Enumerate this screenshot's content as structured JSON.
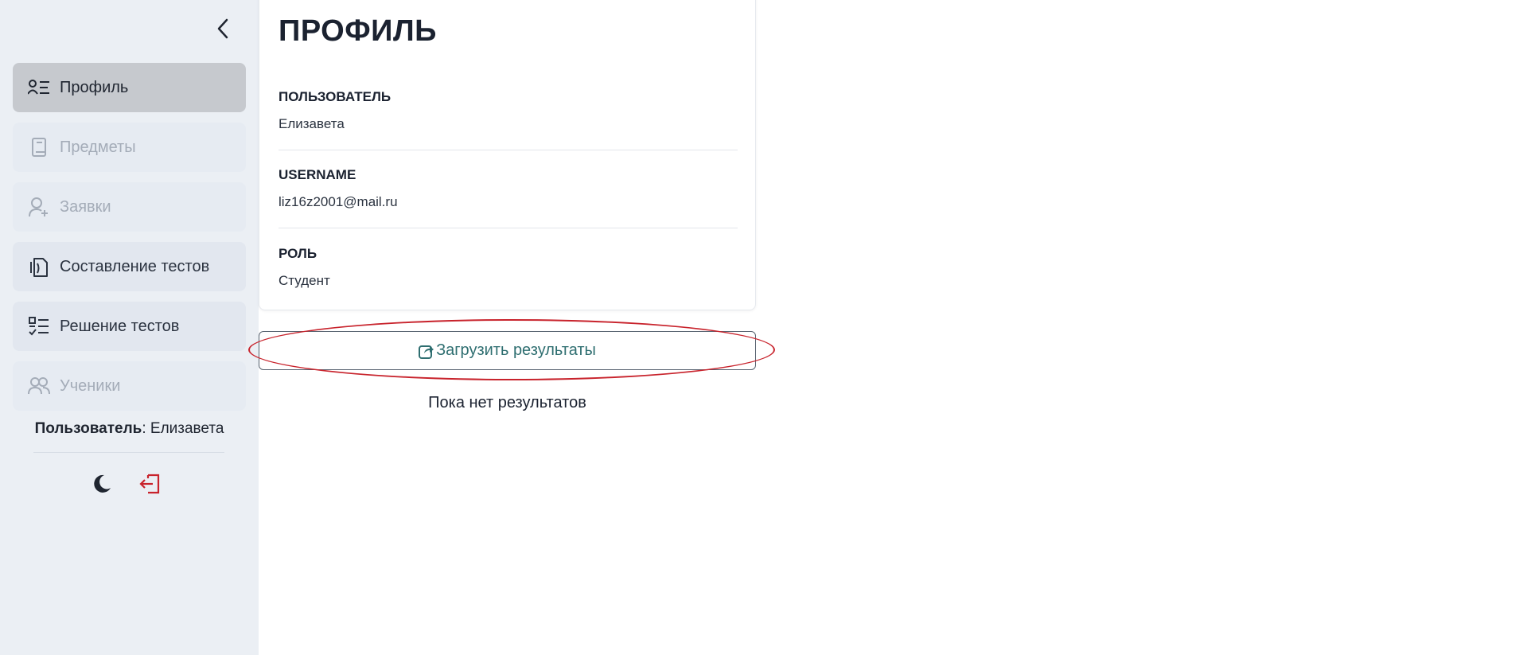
{
  "sidebar": {
    "collapse_icon": "chevron-left-icon",
    "items": [
      {
        "label": "Профиль",
        "icon": "profile-list-icon",
        "state": "active"
      },
      {
        "label": "Предметы",
        "icon": "book-icon",
        "state": "disabled"
      },
      {
        "label": "Заявки",
        "icon": "user-add-icon",
        "state": "disabled"
      },
      {
        "label": "Составление тестов",
        "icon": "documents-icon",
        "state": "normal"
      },
      {
        "label": "Решение тестов",
        "icon": "checklist-icon",
        "state": "normal"
      },
      {
        "label": "Ученики",
        "icon": "users-icon",
        "state": "disabled"
      }
    ],
    "user_prefix": "Пользователь",
    "user_separator": ": ",
    "user_name": "Елизавета",
    "theme_icon": "moon-icon",
    "logout_icon": "logout-icon"
  },
  "profile": {
    "title": "ПРОФИЛЬ",
    "fields": [
      {
        "label": "ПОЛЬЗОВАТЕЛЬ",
        "value": "Елизавета"
      },
      {
        "label": "USERNAME",
        "value": "liz16z2001@mail.ru"
      },
      {
        "label": "РОЛЬ",
        "value": "Студент"
      }
    ]
  },
  "results": {
    "upload_label": "Загрузить результаты",
    "upload_icon": "share-icon",
    "empty_text": "Пока нет результатов"
  },
  "colors": {
    "sidebar_bg": "#ebeff4",
    "active_item_bg": "#c6c9ce",
    "accent_teal": "#2e6e70",
    "logout_red": "#c8232c",
    "highlight_red": "#c8232c"
  }
}
